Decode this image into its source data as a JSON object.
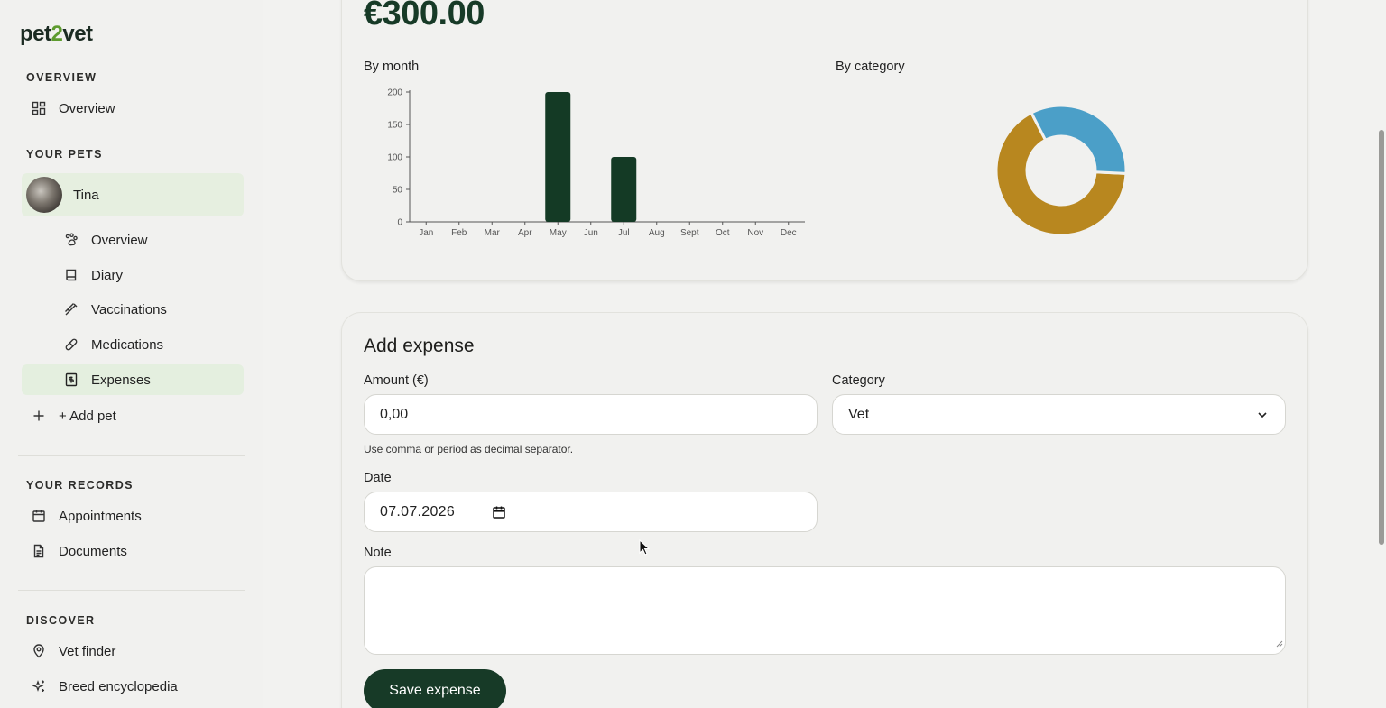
{
  "app": {
    "logo_prefix": "pet",
    "logo_mid": "2",
    "logo_suffix": "vet"
  },
  "sidebar": {
    "overview_section": "OVERVIEW",
    "overview_item": "Overview",
    "pets_section": "YOUR PETS",
    "pet_name": "Tina",
    "pet_items": [
      {
        "label": "Overview",
        "icon": "paw-icon"
      },
      {
        "label": "Diary",
        "icon": "book-icon"
      },
      {
        "label": "Vaccinations",
        "icon": "syringe-icon"
      },
      {
        "label": "Medications",
        "icon": "pill-icon"
      },
      {
        "label": "Expenses",
        "icon": "receipt-icon"
      }
    ],
    "add_pet": "+ Add pet",
    "records_section": "YOUR RECORDS",
    "records_items": [
      {
        "label": "Appointments",
        "icon": "calendar-icon"
      },
      {
        "label": "Documents",
        "icon": "document-icon"
      }
    ],
    "discover_section": "DISCOVER",
    "discover_items": [
      {
        "label": "Vet finder",
        "icon": "map-pin-icon"
      },
      {
        "label": "Breed encyclopedia",
        "icon": "sparkles-icon"
      }
    ]
  },
  "summary": {
    "total": "€300.00",
    "by_month_title": "By month",
    "by_category_title": "By category"
  },
  "chart_data": [
    {
      "type": "bar",
      "title": "By month",
      "categories": [
        "Jan",
        "Feb",
        "Mar",
        "Apr",
        "May",
        "Jun",
        "Jul",
        "Aug",
        "Sept",
        "Oct",
        "Nov",
        "Dec"
      ],
      "values": [
        0,
        0,
        0,
        0,
        200,
        0,
        100,
        0,
        0,
        0,
        0,
        0
      ],
      "yticks": [
        0,
        50,
        100,
        150,
        200
      ],
      "ylim": [
        0,
        200
      ],
      "color": "#143a25"
    },
    {
      "type": "pie",
      "title": "By category",
      "donut": true,
      "slices": [
        {
          "value": 200,
          "color": "#b8871f"
        },
        {
          "value": 100,
          "color": "#4b9fc8"
        }
      ]
    }
  ],
  "form": {
    "title": "Add expense",
    "amount_label": "Amount (€)",
    "amount_value": "0,00",
    "amount_hint": "Use comma or period as decimal separator.",
    "category_label": "Category",
    "category_value": "Vet",
    "date_label": "Date",
    "date_value": "07.07.2026",
    "note_label": "Note",
    "save_label": "Save expense"
  }
}
